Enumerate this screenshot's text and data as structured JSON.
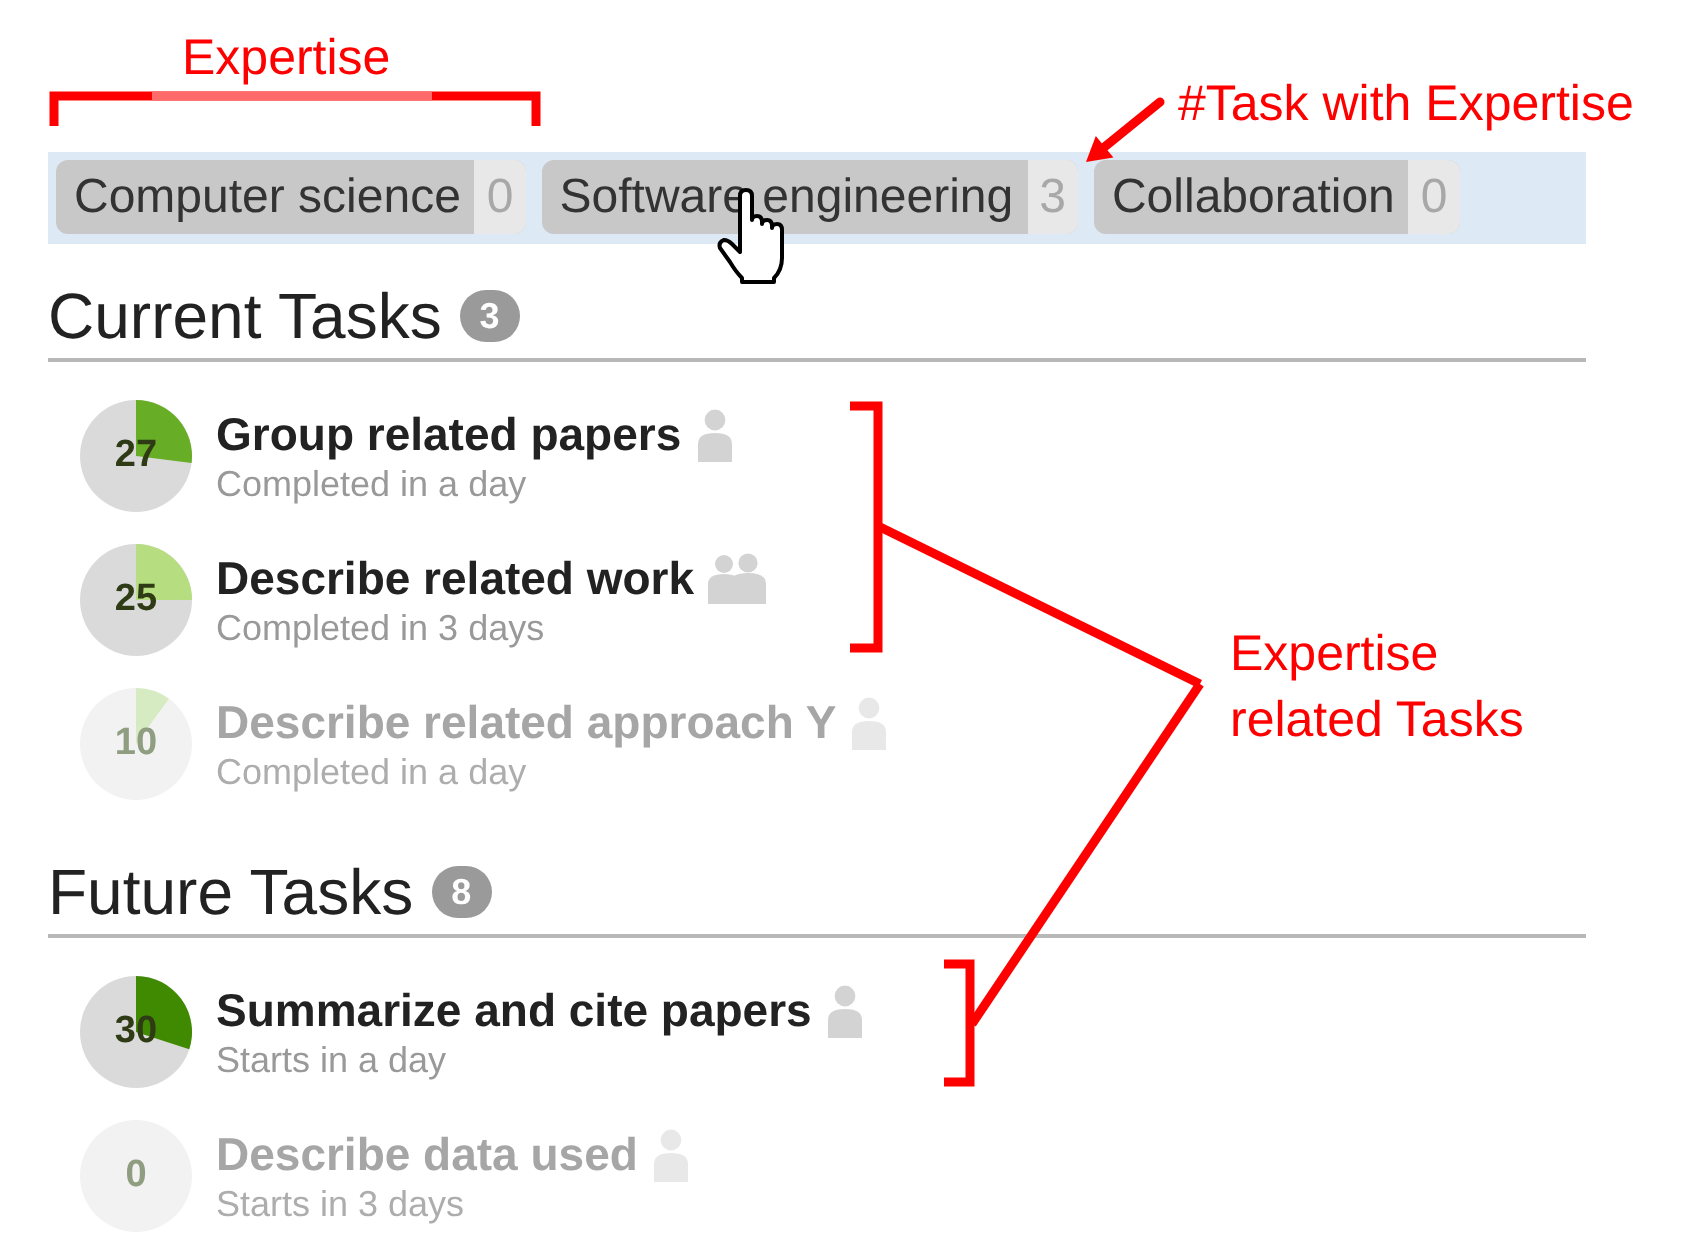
{
  "annotations": {
    "expertise_label": "Expertise",
    "count_label": "#Task with Expertise",
    "tasks_label": "Expertise related Tasks"
  },
  "expertise_tags": [
    {
      "label": "Computer science",
      "count": "0"
    },
    {
      "label": "Software engineering",
      "count": "3"
    },
    {
      "label": "Collaboration",
      "count": "0"
    }
  ],
  "sections": [
    {
      "title": "Current Tasks",
      "count": "3",
      "tasks": [
        {
          "title": "Group related papers",
          "subtitle": "Completed in a day",
          "progress": "27",
          "color": "#67ad25",
          "team": false,
          "disabled": false
        },
        {
          "title": "Describe related work",
          "subtitle": "Completed in 3 days",
          "progress": "25",
          "color": "#b6dd80",
          "team": true,
          "disabled": false
        },
        {
          "title": "Describe related approach Y",
          "subtitle": "Completed in a day",
          "progress": "10",
          "color": "#d7ebc3",
          "team": false,
          "disabled": true
        }
      ]
    },
    {
      "title": "Future Tasks",
      "count": "8",
      "tasks": [
        {
          "title": "Summarize and cite papers",
          "subtitle": "Starts in a day",
          "progress": "30",
          "color": "#3f8a00",
          "team": false,
          "disabled": false
        },
        {
          "title": "Describe data used",
          "subtitle": "Starts in 3 days",
          "progress": "0",
          "team": false,
          "disabled": true
        }
      ]
    }
  ]
}
